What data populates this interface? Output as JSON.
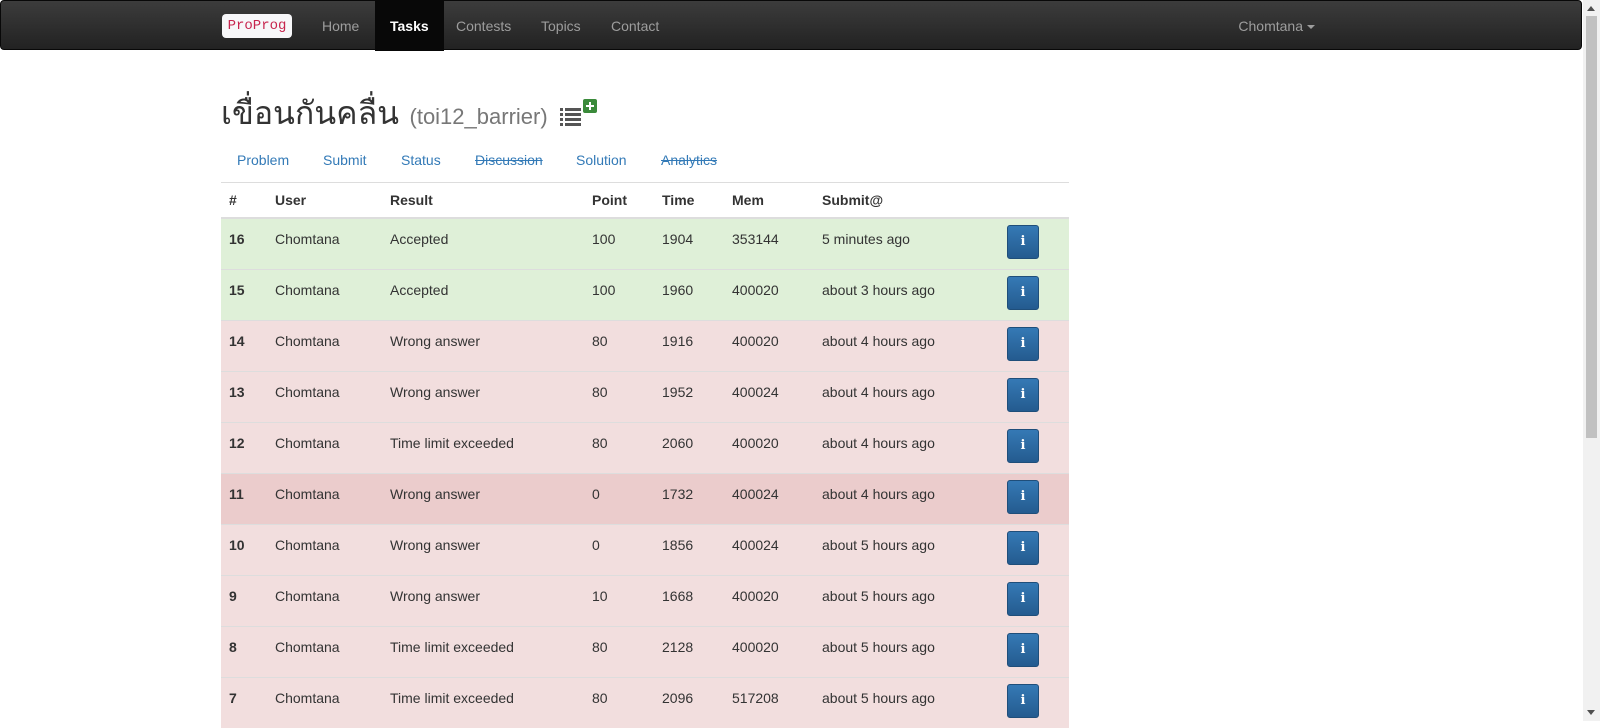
{
  "nav": {
    "brand": "ProProg",
    "links": [
      "Home",
      "Tasks",
      "Contests",
      "Topics",
      "Contact"
    ],
    "active": "Tasks",
    "user": "Chomtana"
  },
  "task": {
    "title": "เขื่อนกันคลื่น",
    "code": "(toi12_barrier)"
  },
  "tabs": [
    {
      "label": "Problem",
      "struck": false
    },
    {
      "label": "Submit",
      "struck": false
    },
    {
      "label": "Status",
      "struck": false
    },
    {
      "label": "Discussion",
      "struck": true
    },
    {
      "label": "Solution",
      "struck": false
    },
    {
      "label": "Analytics",
      "struck": true
    }
  ],
  "table": {
    "headers": [
      "#",
      "User",
      "Result",
      "Point",
      "Time",
      "Mem",
      "Submit@",
      ""
    ],
    "info_glyph": "i",
    "rows": [
      {
        "id": "16",
        "user": "Chomtana",
        "result": "Accepted",
        "point": "100",
        "time": "1904",
        "mem": "353144",
        "submitted": "5 minutes ago",
        "status": "success"
      },
      {
        "id": "15",
        "user": "Chomtana",
        "result": "Accepted",
        "point": "100",
        "time": "1960",
        "mem": "400020",
        "submitted": "about 3 hours ago",
        "status": "success"
      },
      {
        "id": "14",
        "user": "Chomtana",
        "result": "Wrong answer",
        "point": "80",
        "time": "1916",
        "mem": "400020",
        "submitted": "about 4 hours ago",
        "status": "danger"
      },
      {
        "id": "13",
        "user": "Chomtana",
        "result": "Wrong answer",
        "point": "80",
        "time": "1952",
        "mem": "400024",
        "submitted": "about 4 hours ago",
        "status": "danger"
      },
      {
        "id": "12",
        "user": "Chomtana",
        "result": "Time limit exceeded",
        "point": "80",
        "time": "2060",
        "mem": "400020",
        "submitted": "about 4 hours ago",
        "status": "danger"
      },
      {
        "id": "11",
        "user": "Chomtana",
        "result": "Wrong answer",
        "point": "0",
        "time": "1732",
        "mem": "400024",
        "submitted": "about 4 hours ago",
        "status": "danger",
        "hover": true
      },
      {
        "id": "10",
        "user": "Chomtana",
        "result": "Wrong answer",
        "point": "0",
        "time": "1856",
        "mem": "400024",
        "submitted": "about 5 hours ago",
        "status": "danger"
      },
      {
        "id": "9",
        "user": "Chomtana",
        "result": "Wrong answer",
        "point": "10",
        "time": "1668",
        "mem": "400020",
        "submitted": "about 5 hours ago",
        "status": "danger"
      },
      {
        "id": "8",
        "user": "Chomtana",
        "result": "Time limit exceeded",
        "point": "80",
        "time": "2128",
        "mem": "400020",
        "submitted": "about 5 hours ago",
        "status": "danger"
      },
      {
        "id": "7",
        "user": "Chomtana",
        "result": "Time limit exceeded",
        "point": "80",
        "time": "2096",
        "mem": "517208",
        "submitted": "about 5 hours ago",
        "status": "danger"
      }
    ]
  },
  "colors": {
    "success_row": "#dff0d8",
    "danger_row": "#f2dede",
    "link": "#337ab7",
    "navbar": "#222222"
  }
}
